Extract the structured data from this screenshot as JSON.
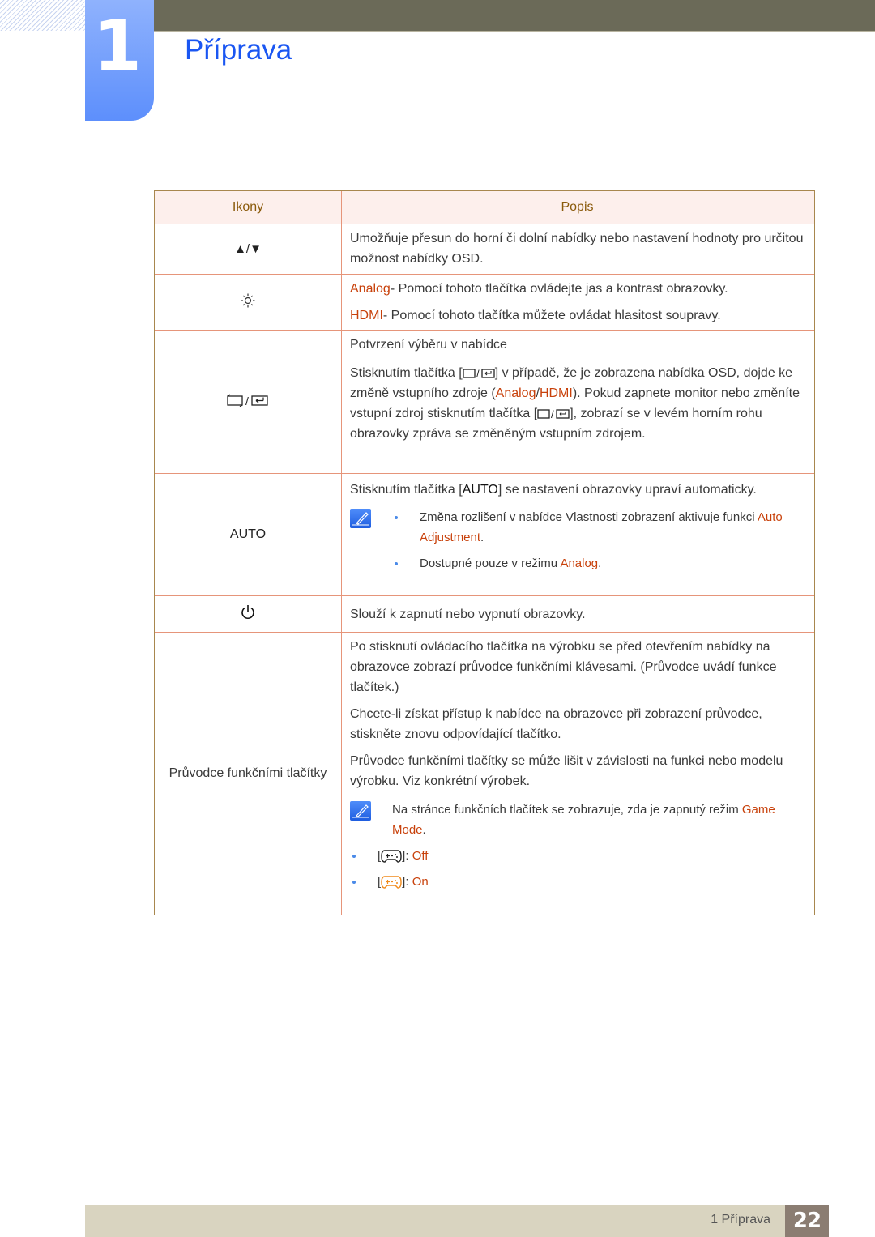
{
  "header": {
    "chapter_number": "1",
    "title": "Příprava"
  },
  "table": {
    "headers": {
      "icons": "Ikony",
      "description": "Popis"
    },
    "rows": [
      {
        "icon": "up-down-arrows",
        "icon_text": "▲/▼",
        "text": "Umožňuje přesun do horní či dolní nabídky nebo nastavení hodnoty pro určitou možnost nabídky OSD."
      },
      {
        "icon": "brightness-icon",
        "lines": [
          {
            "hl": "Analog",
            "rest": "- Pomocí tohoto tlačítka ovládejte jas a kontrast obrazovky."
          },
          {
            "hl": "HDMI",
            "rest": "- Pomocí tohoto tlačítka můžete ovládat hlasitost soupravy."
          }
        ]
      },
      {
        "icon": "source-enter-icon",
        "p1": "Potvrzení výběru v nabídce",
        "p2_a": "Stisknutím tlačítka [",
        "p2_b": "] v případě, že je zobrazena nabídka OSD, dojde ke změně vstupního zdroje (",
        "p2_hl1": "Analog",
        "p2_sep": "/",
        "p2_hl2": "HDMI",
        "p2_c": "). Pokud zapnete monitor nebo změníte vstupní zdroj stisknutím tlačítka [",
        "p2_d": "], zobrazí se v levém horním rohu obrazovky zpráva se změněným vstupním zdrojem."
      },
      {
        "icon_text": "AUTO",
        "p1_a": "Stisknutím tlačítka [",
        "p1_btn": "AUTO",
        "p1_b": "] se nastavení obrazovky upraví automaticky.",
        "bullets": [
          {
            "a": "Změna rozlišení v nabídce Vlastnosti zobrazení aktivuje funkci ",
            "hl": "Auto Adjustment",
            "b": "."
          },
          {
            "a": "Dostupné pouze v režimu ",
            "hl": "Analog",
            "b": "."
          }
        ]
      },
      {
        "icon": "power-icon",
        "text": "Slouží k zapnutí nebo vypnutí obrazovky."
      },
      {
        "icon_text": "Průvodce funkčními tlačítky",
        "p1": "Po stisknutí ovládacího tlačítka na výrobku se před otevřením nabídky na obrazovce zobrazí průvodce funkčními klávesami. (Průvodce uvádí funkce tlačítek.)",
        "p2": "Chcete-li získat přístup k nabídce na obrazovce při zobrazení průvodce, stiskněte znovu odpovídající tlačítko.",
        "p3": "Průvodce funkčními tlačítky se může lišit v závislosti na funkci nebo modelu výrobku. Viz konkrétní výrobek.",
        "note_a": "Na stránce funkčních tlačítek se zobrazuje, zda je zapnutý režim ",
        "note_hl": "Game Mode",
        "note_b": ".",
        "modes": [
          {
            "open": "[",
            "close": "]: ",
            "state": "Off",
            "icon_color": "#222222"
          },
          {
            "open": "[",
            "close": "]: ",
            "state": "On",
            "icon_color": "#f08a1c"
          }
        ]
      }
    ]
  },
  "footer": {
    "section_label": "1 Příprava",
    "page_number": "22"
  },
  "colors": {
    "title_blue": "#1a56f2",
    "highlight": "#c8410b",
    "header_text": "#8a5a0b"
  }
}
